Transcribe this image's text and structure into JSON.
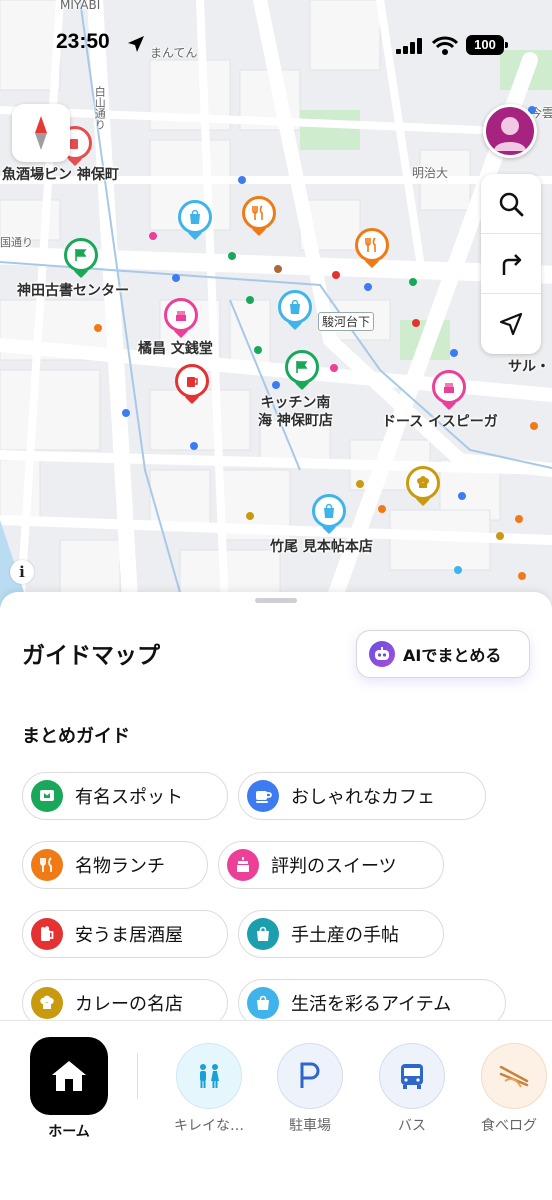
{
  "status_bar": {
    "time": "23:50",
    "battery": "100"
  },
  "map": {
    "labels": {
      "miyabi": "MIYABI",
      "manten": "まんてん",
      "hakusan_dori": "白山通り",
      "meijidai": "明治大",
      "kuni_dori": "国通り",
      "uoshuba": "魚酒場ピン 神保町",
      "kanda_koshoten": "神田古書センター",
      "kitsuhou": "橘昌 文銭堂",
      "kitchen_minami": "キッチン南\n海 神保町店",
      "surugadaishita": "駿河台下",
      "doors": "ドース イスピーガ",
      "sal": "サル・",
      "takeo": "竹尾 見本帖本店",
      "kanjuku": "今雲"
    }
  },
  "sheet": {
    "title": "ガイドマップ",
    "ai_button": "AIでまとめる",
    "section_title": "まとめガイド",
    "chips": [
      {
        "label": "有名スポット",
        "icon": "flag-icon",
        "color": "#19a85a"
      },
      {
        "label": "おしゃれなカフェ",
        "icon": "cup-icon",
        "color": "#3d7cf0"
      },
      {
        "label": "名物ランチ",
        "icon": "fork-knife-icon",
        "color": "#f07b16"
      },
      {
        "label": "評判のスイーツ",
        "icon": "cake-icon",
        "color": "#ec3f97"
      },
      {
        "label": "安うま居酒屋",
        "icon": "beer-icon",
        "color": "#e43232"
      },
      {
        "label": "手土産の手帖",
        "icon": "gift-bag-icon",
        "color": "#1b9fae"
      },
      {
        "label": "カレーの名店",
        "icon": "chef-hat-icon",
        "color": "#c99a0e"
      },
      {
        "label": "生活を彩るアイテム",
        "icon": "shopping-bag-icon",
        "color": "#3fb4ea"
      }
    ]
  },
  "tabbar": {
    "home": "ホーム",
    "tabs": [
      {
        "label": "キレイな…",
        "icon": "restroom-icon"
      },
      {
        "label": "駐車場",
        "icon": "parking-icon"
      },
      {
        "label": "バス",
        "icon": "bus-icon"
      },
      {
        "label": "食べログ",
        "icon": "chopsticks-icon"
      }
    ]
  }
}
